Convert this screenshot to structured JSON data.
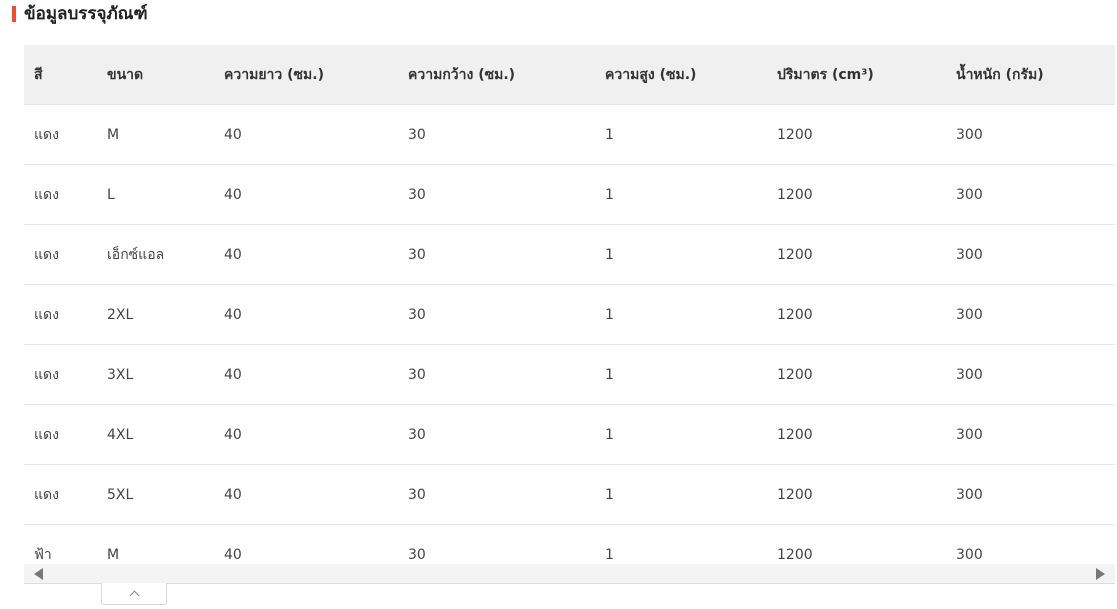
{
  "section": {
    "title": "ข้อมูลบรรจุภัณฑ์",
    "accent_color": "#ee4d2d"
  },
  "table": {
    "headers": [
      "สี",
      "ขนาด",
      "ความยาว (ซม.)",
      "ความกว้าง (ซม.)",
      "ความสูง (ซม.)",
      "ปริมาตร (cm³)",
      "น้ำหนัก (กรัม)"
    ],
    "rows": [
      [
        "แดง",
        "M",
        "40",
        "30",
        "1",
        "1200",
        "300"
      ],
      [
        "แดง",
        "L",
        "40",
        "30",
        "1",
        "1200",
        "300"
      ],
      [
        "แดง",
        "เอ็กซ์แอล",
        "40",
        "30",
        "1",
        "1200",
        "300"
      ],
      [
        "แดง",
        "2XL",
        "40",
        "30",
        "1",
        "1200",
        "300"
      ],
      [
        "แดง",
        "3XL",
        "40",
        "30",
        "1",
        "1200",
        "300"
      ],
      [
        "แดง",
        "4XL",
        "40",
        "30",
        "1",
        "1200",
        "300"
      ],
      [
        "แดง",
        "5XL",
        "40",
        "30",
        "1",
        "1200",
        "300"
      ],
      [
        "ฟ้า",
        "M",
        "40",
        "30",
        "1",
        "1200",
        "300"
      ]
    ]
  },
  "icons": {
    "scroll_left": "caret-left-icon",
    "scroll_right": "caret-right-icon",
    "collapse": "chevron-up-icon"
  }
}
